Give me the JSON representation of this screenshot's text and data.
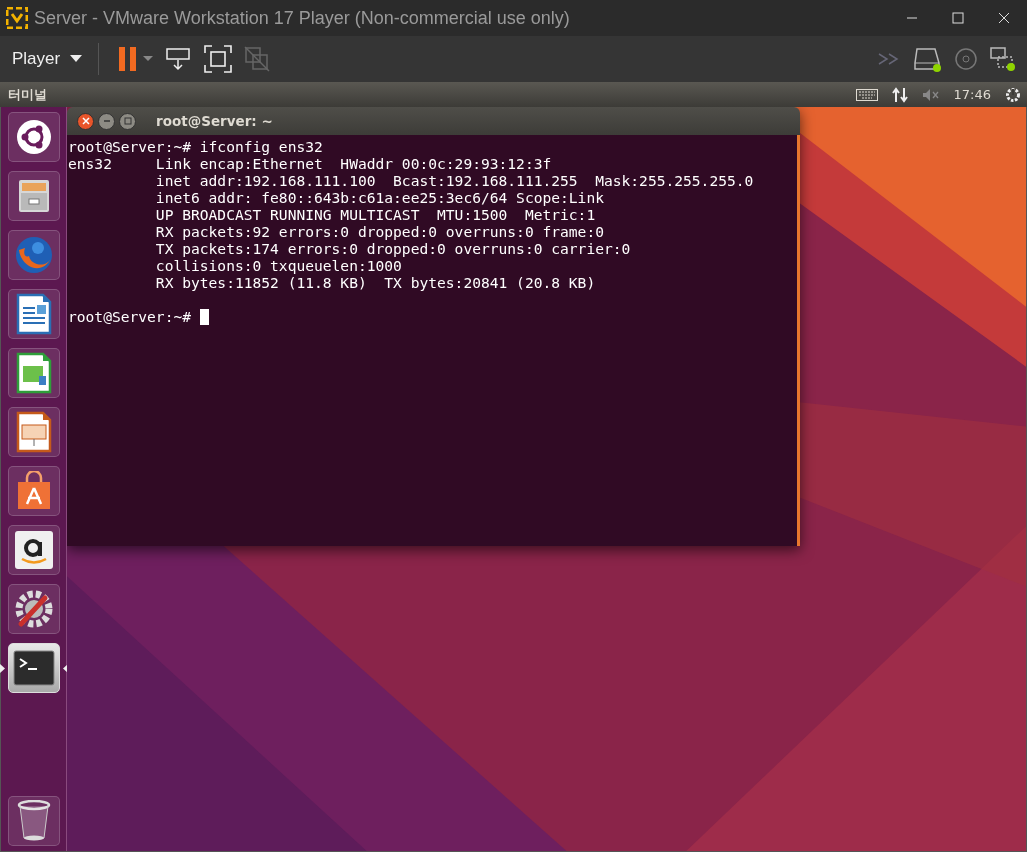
{
  "window": {
    "title": "Server - VMware Workstation 17 Player (Non-commercial use only)"
  },
  "toolbar": {
    "menu": "Player"
  },
  "panel": {
    "app_name": "터미널",
    "clock": "17:46"
  },
  "launcher": {
    "items": [
      {
        "kind": "dash",
        "active": false
      },
      {
        "kind": "files",
        "active": false
      },
      {
        "kind": "browser",
        "active": false
      },
      {
        "kind": "writer",
        "active": false
      },
      {
        "kind": "calc",
        "active": false
      },
      {
        "kind": "impress",
        "active": false
      },
      {
        "kind": "store",
        "active": false
      },
      {
        "kind": "amazon",
        "active": false
      },
      {
        "kind": "settings",
        "active": false
      },
      {
        "kind": "terminal",
        "active": true
      },
      {
        "kind": "trash",
        "active": false
      }
    ]
  },
  "terminal": {
    "title": "root@Server: ~",
    "lines": [
      "root@Server:~# ifconfig ens32",
      "ens32     Link encap:Ethernet  HWaddr 00:0c:29:93:12:3f",
      "          inet addr:192.168.111.100  Bcast:192.168.111.255  Mask:255.255.255.0",
      "          inet6 addr: fe80::643b:c61a:ee25:3ec6/64 Scope:Link",
      "          UP BROADCAST RUNNING MULTICAST  MTU:1500  Metric:1",
      "          RX packets:92 errors:0 dropped:0 overruns:0 frame:0",
      "          TX packets:174 errors:0 dropped:0 overruns:0 carrier:0",
      "          collisions:0 txqueuelen:1000",
      "          RX bytes:11852 (11.8 KB)  TX bytes:20841 (20.8 KB)"
    ],
    "prompt": "root@Server:~#"
  }
}
